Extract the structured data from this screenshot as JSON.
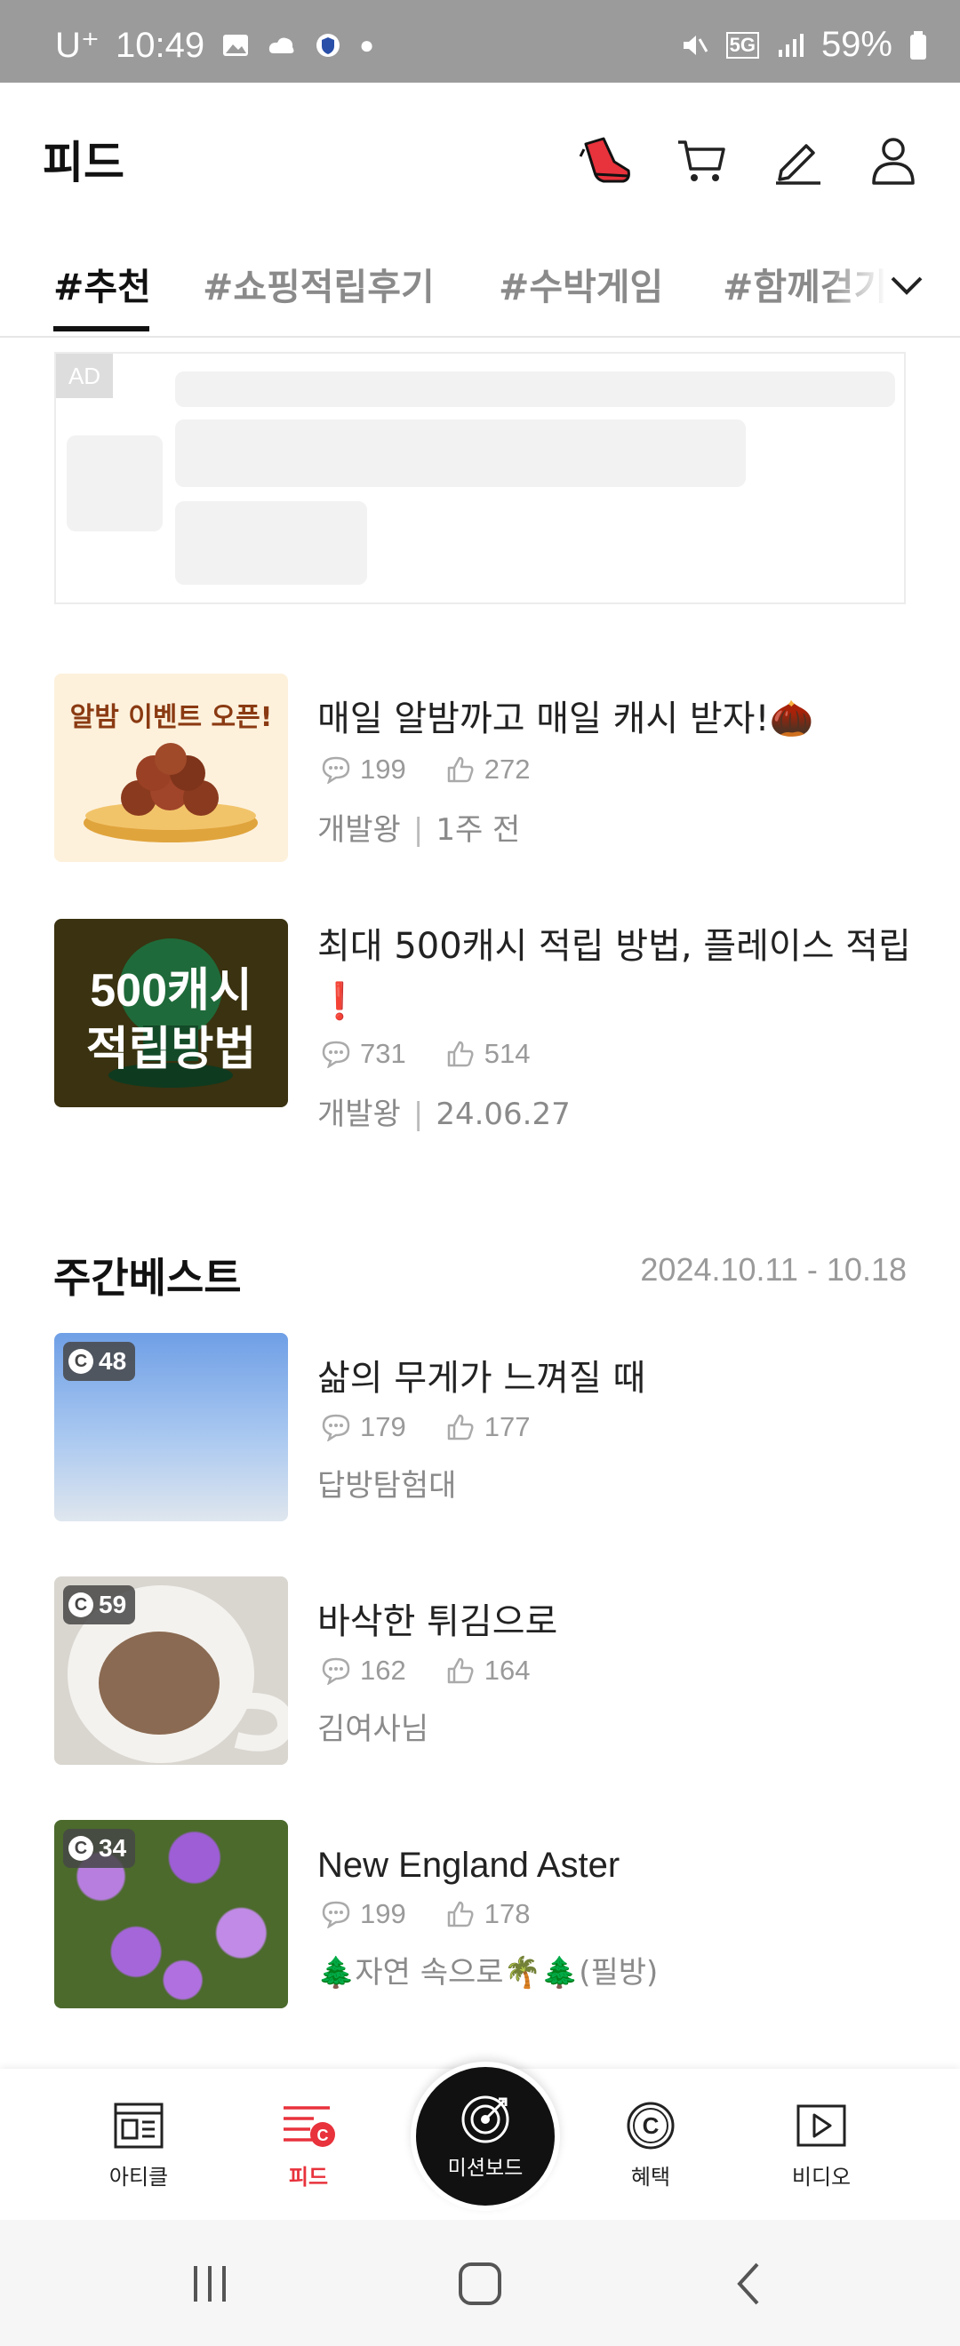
{
  "status_bar": {
    "carrier": "U⁺",
    "time": "10:49",
    "network": "5G",
    "battery": "59%"
  },
  "header": {
    "title": "피드",
    "icons": [
      "shoe-icon",
      "cart-icon",
      "pencil-icon",
      "person-icon"
    ]
  },
  "tabs": [
    {
      "label": "#추천",
      "active": true
    },
    {
      "label": "#쇼핑적립후기",
      "active": false
    },
    {
      "label": "#수박게임",
      "active": false
    },
    {
      "label": "#함께걷기인증",
      "active": false
    }
  ],
  "ad": {
    "label": "AD"
  },
  "posts": [
    {
      "thumb_text": "알밤 이벤트 오픈!",
      "title": "매일 알밤까고 매일 캐시 받자!🌰",
      "comments": "199",
      "likes": "272",
      "author": "개발왕",
      "date": "1주 전"
    },
    {
      "thumb_text_1": "500캐시",
      "thumb_text_2": "적립방법",
      "title": "최대 500캐시 적립 방법, 플레이스 적립❗",
      "comments": "731",
      "likes": "514",
      "author": "개발왕",
      "date": "24.06.27"
    }
  ],
  "weekly_best": {
    "title": "주간베스트",
    "date_range": "2024.10.11 - 10.18",
    "items": [
      {
        "badge": "48",
        "title": "삶의 무게가 느껴질 때",
        "comments": "179",
        "likes": "177",
        "author": "답방탐험대"
      },
      {
        "badge": "59",
        "title": "바삭한 튀김으로",
        "comments": "162",
        "likes": "164",
        "author": "김여사님"
      },
      {
        "badge": "34",
        "title": "New England Aster",
        "comments": "199",
        "likes": "178",
        "author": "🌲자연 속으로🌴🌲(필방)"
      }
    ]
  },
  "bottom_nav": {
    "items": [
      {
        "label": "아티클",
        "active": false
      },
      {
        "label": "피드",
        "active": true
      },
      {
        "label": "미션보드",
        "active": false
      },
      {
        "label": "혜택",
        "active": false
      },
      {
        "label": "비디오",
        "active": false
      }
    ]
  },
  "colors": {
    "accent": "#e8323c",
    "statusbar": "#9b9b9b"
  }
}
